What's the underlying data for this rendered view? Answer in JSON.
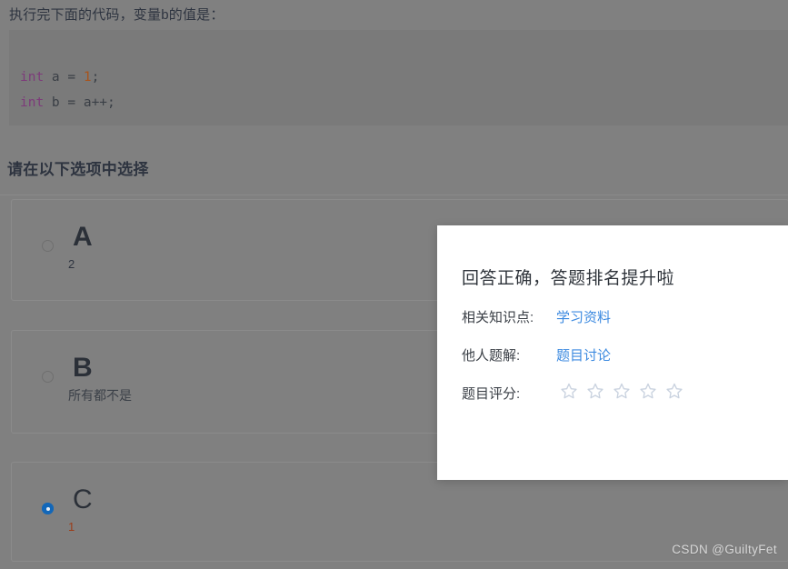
{
  "page": {
    "question_prompt": "执行完下面的代码，变量b的值是：",
    "choose_heading": "请在以下选项中选择",
    "watermark": "CSDN @GuiltyFet",
    "background_color": "#808080",
    "code_background_color": "#7a7a7a"
  },
  "code": {
    "lines": [
      {
        "keyword": "int",
        "rest": " a = ",
        "number": "1",
        "tail": ";"
      },
      {
        "keyword": "int",
        "rest": " b = a++",
        "number": "",
        "tail": ";"
      }
    ],
    "line1_keyword": "int",
    "line1_mid": " a = ",
    "line1_num": "1",
    "line1_end": ";",
    "line2_keyword": "int",
    "line2_rest": " b = a++;",
    "keyword_color": "#7d3b7a",
    "number_color": "#a8541c"
  },
  "options": [
    {
      "letter": "A",
      "text": "2",
      "selected": false,
      "text_style": "num-2"
    },
    {
      "letter": "B",
      "text": "所有都不是",
      "selected": false,
      "text_style": ""
    },
    {
      "letter": "C",
      "text": "1",
      "selected": true,
      "text_style": "num-1"
    }
  ],
  "modal": {
    "title": "回答正确，答题排名提升啦",
    "rows": [
      {
        "label": "相关知识点:",
        "link": "学习资料"
      },
      {
        "label": "他人题解:",
        "link": "题目讨论"
      },
      {
        "label": "题目评分:",
        "link": ""
      }
    ],
    "rating": {
      "stars_total": 5,
      "stars_filled": 0,
      "star_color": "#c9d2df"
    },
    "link_color": "#3c8ae0"
  }
}
